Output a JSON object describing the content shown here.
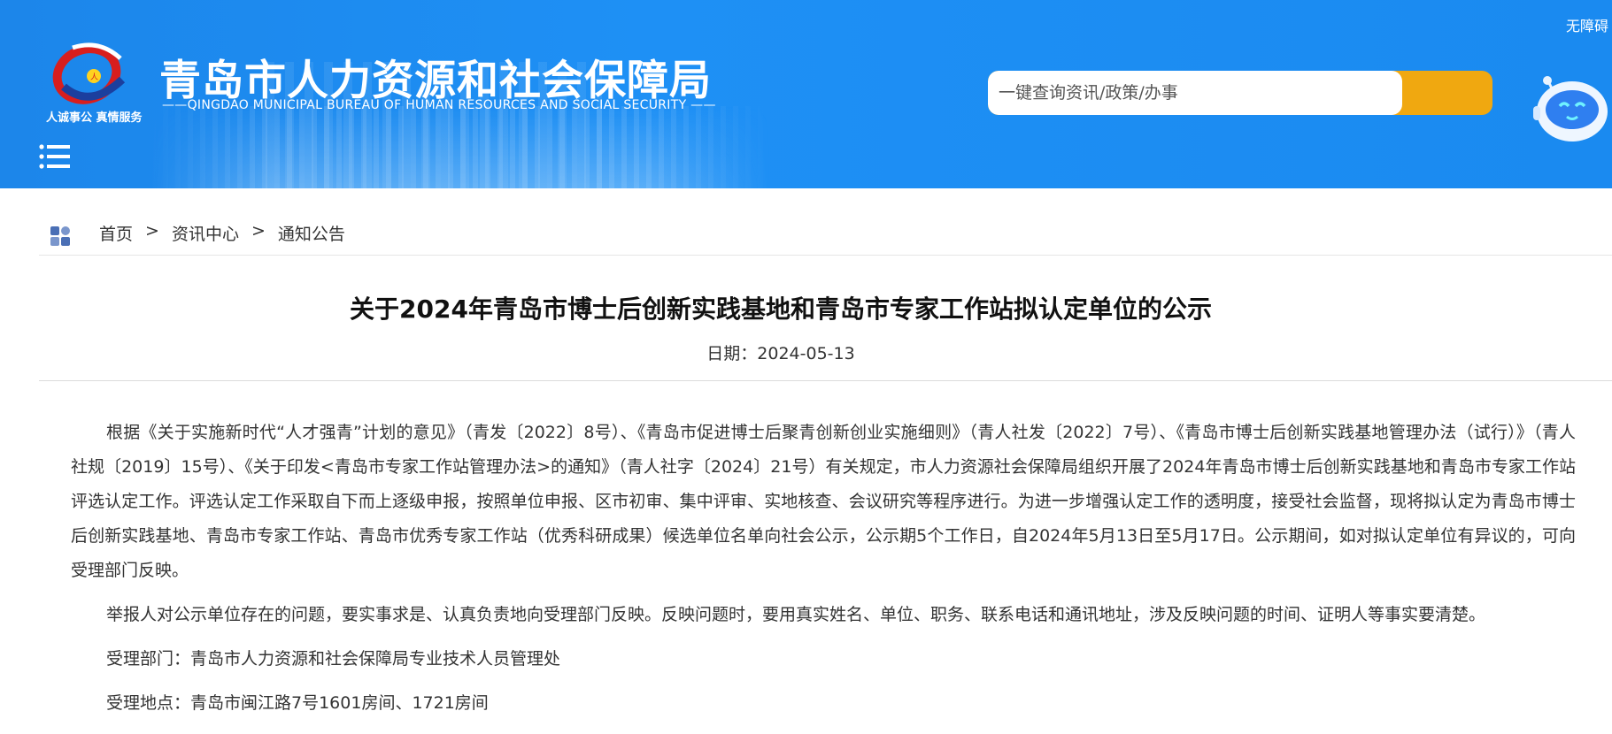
{
  "header": {
    "org_title": "青岛市人力资源和社会保障局",
    "org_subtitle": "——QINGDAO MUNICIPAL BUREAU OF HUMAN RESOURCES AND SOCIAL SECURITY ——",
    "logo_slogan": "人诚事公  真情服务",
    "accessibility_label": "无障碍",
    "search_placeholder": "一键查询资讯/政策/办事",
    "colors": {
      "banner": "#1c86ea",
      "search_button": "#f0a810"
    },
    "icons": [
      "bureau-logo-icon",
      "menu-icon",
      "search-icon",
      "robot-assistant-icon"
    ]
  },
  "breadcrumb": {
    "items": [
      "首页",
      "资讯中心",
      "通知公告"
    ],
    "separator": ">"
  },
  "article": {
    "title": "关于2024年青岛市博士后创新实践基地和青岛市专家工作站拟认定单位的公示",
    "date": "日期：2024-05-13",
    "paragraphs": [
      "根据《关于实施新时代“人才强青”计划的意见》（青发〔2022〕8号）、《青岛市促进博士后聚青创新创业实施细则》（青人社发〔2022〕7号）、《青岛市博士后创新实践基地管理办法（试行）》（青人社规〔2019〕15号）、《关于印发<青岛市专家工作站管理办法>的通知》（青人社字〔2024〕21号）有关规定，市人力资源社会保障局组织开展了2024年青岛市博士后创新实践基地和青岛市专家工作站评选认定工作。评选认定工作采取自下而上逐级申报，按照单位申报、区市初审、集中评审、实地核查、会议研究等程序进行。为进一步增强认定工作的透明度，接受社会监督，现将拟认定为青岛市博士后创新实践基地、青岛市专家工作站、青岛市优秀专家工作站（优秀科研成果）候选单位名单向社会公示，公示期5个工作日，自2024年5月13日至5月17日。公示期间，如对拟认定单位有异议的，可向受理部门反映。",
      "举报人对公示单位存在的问题，要实事求是、认真负责地向受理部门反映。反映问题时，要用真实姓名、单位、职务、联系电话和通讯地址，涉及反映问题的时间、证明人等事实要清楚。",
      "受理部门：青岛市人力资源和社会保障局专业技术人员管理处",
      "受理地点：青岛市闽江路7号1601房间、1721房间"
    ]
  }
}
